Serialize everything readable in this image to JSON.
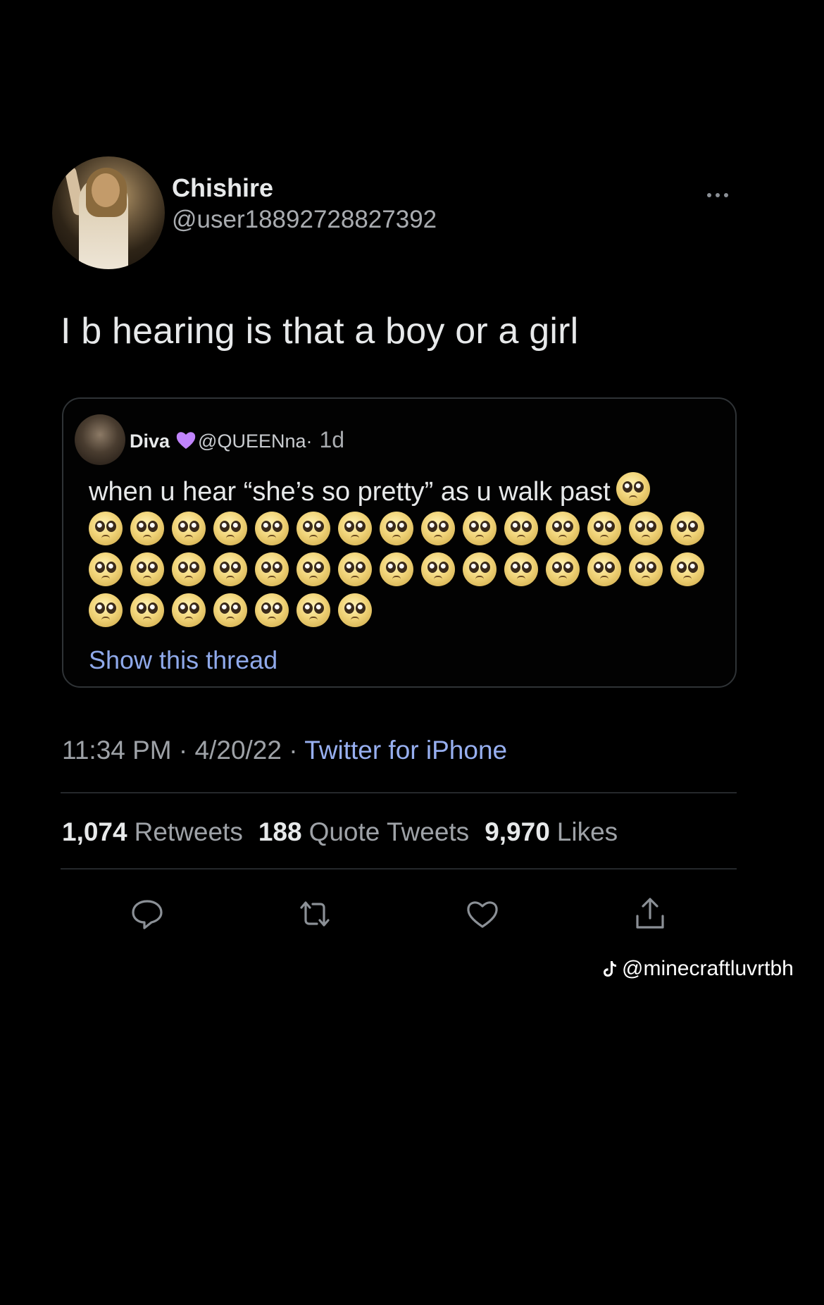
{
  "author": {
    "name": "Chishire",
    "handle": "@user18892728827392"
  },
  "tweet": {
    "text": "I b hearing is that a boy or a girl"
  },
  "quote": {
    "name": "Diva",
    "handle": "@QUEENna·",
    "time": "1d",
    "text": "when u hear “she’s so pretty” as u walk past",
    "emoji_name": "pleading-face",
    "emoji_rows": [
      15,
      15,
      7
    ],
    "show_thread": "Show this thread"
  },
  "meta": {
    "time": "11:34 PM",
    "date": "4/20/22",
    "sep": " · ",
    "source": "Twitter for iPhone"
  },
  "stats": {
    "retweets_count": "1,074",
    "retweets_label": "Retweets",
    "quotes_count": "188",
    "quotes_label": "Quote Tweets",
    "likes_count": "9,970",
    "likes_label": "Likes"
  },
  "actions": [
    "reply-icon",
    "retweet-icon",
    "like-icon",
    "share-icon"
  ],
  "watermark": "@minecraftluvrtbh",
  "colors": {
    "background": "#000000",
    "text": "#e7e9ea",
    "muted": "#9ea2a7",
    "link": "#8fa9ea",
    "heart": "#c084fc"
  }
}
